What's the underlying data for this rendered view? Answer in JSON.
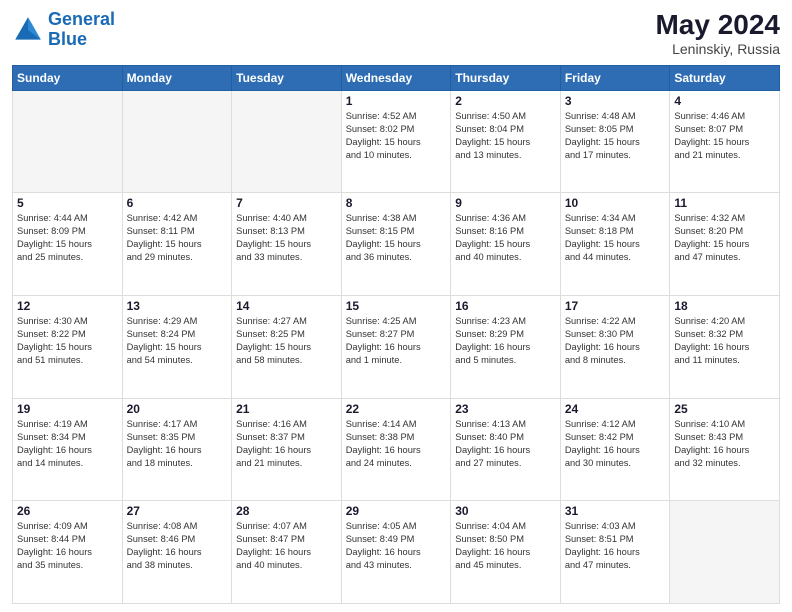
{
  "header": {
    "logo_line1": "General",
    "logo_line2": "Blue",
    "month_year": "May 2024",
    "location": "Leninskiy, Russia"
  },
  "weekdays": [
    "Sunday",
    "Monday",
    "Tuesday",
    "Wednesday",
    "Thursday",
    "Friday",
    "Saturday"
  ],
  "weeks": [
    [
      {
        "day": "",
        "info": ""
      },
      {
        "day": "",
        "info": ""
      },
      {
        "day": "",
        "info": ""
      },
      {
        "day": "1",
        "info": "Sunrise: 4:52 AM\nSunset: 8:02 PM\nDaylight: 15 hours\nand 10 minutes."
      },
      {
        "day": "2",
        "info": "Sunrise: 4:50 AM\nSunset: 8:04 PM\nDaylight: 15 hours\nand 13 minutes."
      },
      {
        "day": "3",
        "info": "Sunrise: 4:48 AM\nSunset: 8:05 PM\nDaylight: 15 hours\nand 17 minutes."
      },
      {
        "day": "4",
        "info": "Sunrise: 4:46 AM\nSunset: 8:07 PM\nDaylight: 15 hours\nand 21 minutes."
      }
    ],
    [
      {
        "day": "5",
        "info": "Sunrise: 4:44 AM\nSunset: 8:09 PM\nDaylight: 15 hours\nand 25 minutes."
      },
      {
        "day": "6",
        "info": "Sunrise: 4:42 AM\nSunset: 8:11 PM\nDaylight: 15 hours\nand 29 minutes."
      },
      {
        "day": "7",
        "info": "Sunrise: 4:40 AM\nSunset: 8:13 PM\nDaylight: 15 hours\nand 33 minutes."
      },
      {
        "day": "8",
        "info": "Sunrise: 4:38 AM\nSunset: 8:15 PM\nDaylight: 15 hours\nand 36 minutes."
      },
      {
        "day": "9",
        "info": "Sunrise: 4:36 AM\nSunset: 8:16 PM\nDaylight: 15 hours\nand 40 minutes."
      },
      {
        "day": "10",
        "info": "Sunrise: 4:34 AM\nSunset: 8:18 PM\nDaylight: 15 hours\nand 44 minutes."
      },
      {
        "day": "11",
        "info": "Sunrise: 4:32 AM\nSunset: 8:20 PM\nDaylight: 15 hours\nand 47 minutes."
      }
    ],
    [
      {
        "day": "12",
        "info": "Sunrise: 4:30 AM\nSunset: 8:22 PM\nDaylight: 15 hours\nand 51 minutes."
      },
      {
        "day": "13",
        "info": "Sunrise: 4:29 AM\nSunset: 8:24 PM\nDaylight: 15 hours\nand 54 minutes."
      },
      {
        "day": "14",
        "info": "Sunrise: 4:27 AM\nSunset: 8:25 PM\nDaylight: 15 hours\nand 58 minutes."
      },
      {
        "day": "15",
        "info": "Sunrise: 4:25 AM\nSunset: 8:27 PM\nDaylight: 16 hours\nand 1 minute."
      },
      {
        "day": "16",
        "info": "Sunrise: 4:23 AM\nSunset: 8:29 PM\nDaylight: 16 hours\nand 5 minutes."
      },
      {
        "day": "17",
        "info": "Sunrise: 4:22 AM\nSunset: 8:30 PM\nDaylight: 16 hours\nand 8 minutes."
      },
      {
        "day": "18",
        "info": "Sunrise: 4:20 AM\nSunset: 8:32 PM\nDaylight: 16 hours\nand 11 minutes."
      }
    ],
    [
      {
        "day": "19",
        "info": "Sunrise: 4:19 AM\nSunset: 8:34 PM\nDaylight: 16 hours\nand 14 minutes."
      },
      {
        "day": "20",
        "info": "Sunrise: 4:17 AM\nSunset: 8:35 PM\nDaylight: 16 hours\nand 18 minutes."
      },
      {
        "day": "21",
        "info": "Sunrise: 4:16 AM\nSunset: 8:37 PM\nDaylight: 16 hours\nand 21 minutes."
      },
      {
        "day": "22",
        "info": "Sunrise: 4:14 AM\nSunset: 8:38 PM\nDaylight: 16 hours\nand 24 minutes."
      },
      {
        "day": "23",
        "info": "Sunrise: 4:13 AM\nSunset: 8:40 PM\nDaylight: 16 hours\nand 27 minutes."
      },
      {
        "day": "24",
        "info": "Sunrise: 4:12 AM\nSunset: 8:42 PM\nDaylight: 16 hours\nand 30 minutes."
      },
      {
        "day": "25",
        "info": "Sunrise: 4:10 AM\nSunset: 8:43 PM\nDaylight: 16 hours\nand 32 minutes."
      }
    ],
    [
      {
        "day": "26",
        "info": "Sunrise: 4:09 AM\nSunset: 8:44 PM\nDaylight: 16 hours\nand 35 minutes."
      },
      {
        "day": "27",
        "info": "Sunrise: 4:08 AM\nSunset: 8:46 PM\nDaylight: 16 hours\nand 38 minutes."
      },
      {
        "day": "28",
        "info": "Sunrise: 4:07 AM\nSunset: 8:47 PM\nDaylight: 16 hours\nand 40 minutes."
      },
      {
        "day": "29",
        "info": "Sunrise: 4:05 AM\nSunset: 8:49 PM\nDaylight: 16 hours\nand 43 minutes."
      },
      {
        "day": "30",
        "info": "Sunrise: 4:04 AM\nSunset: 8:50 PM\nDaylight: 16 hours\nand 45 minutes."
      },
      {
        "day": "31",
        "info": "Sunrise: 4:03 AM\nSunset: 8:51 PM\nDaylight: 16 hours\nand 47 minutes."
      },
      {
        "day": "",
        "info": ""
      }
    ]
  ]
}
